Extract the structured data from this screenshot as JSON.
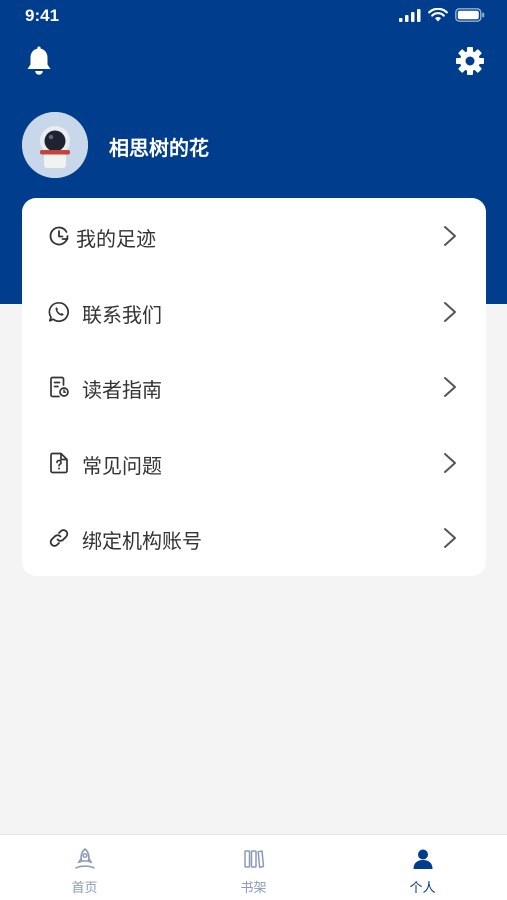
{
  "status_bar": {
    "time": "9:41"
  },
  "header": {
    "bell_icon": "bell-icon",
    "settings_icon": "gear-icon",
    "background_color": "#003d8c"
  },
  "profile": {
    "username": "相思树的花",
    "avatar_icon": "astronaut-avatar"
  },
  "menu": {
    "items": [
      {
        "label": "我的足迹",
        "icon": "history-clock-icon"
      },
      {
        "label": "联系我们",
        "icon": "chat-phone-icon"
      },
      {
        "label": "读者指南",
        "icon": "guide-document-icon"
      },
      {
        "label": "常见问题",
        "icon": "faq-document-icon"
      },
      {
        "label": "绑定机构账号",
        "icon": "link-icon"
      }
    ]
  },
  "tab_bar": {
    "tabs": [
      {
        "label": "首页",
        "icon": "home-rocket-icon",
        "active": false
      },
      {
        "label": "书架",
        "icon": "bookshelf-icon",
        "active": false
      },
      {
        "label": "个人",
        "icon": "person-icon",
        "active": true
      }
    ],
    "active_color": "#003d8c",
    "inactive_color": "#8a9ab8"
  }
}
